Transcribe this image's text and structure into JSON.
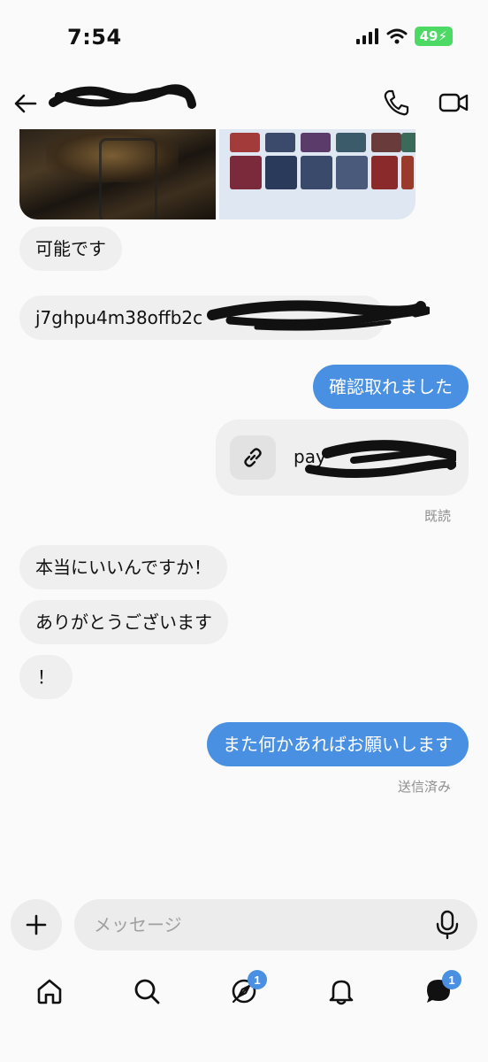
{
  "status_bar": {
    "time": "7:54",
    "battery": "49"
  },
  "header": {
    "contact_name": ""
  },
  "messages": {
    "m1": "可能です",
    "m2": "j7ghpu4m38offb2c",
    "m3": "確認取れました",
    "m4_link": "pay",
    "m4_read": "既読",
    "m5": "本当にいいんですか！",
    "m6": "ありがとうございます",
    "m7": "！",
    "m8": "また何かあればお願いします",
    "m8_status": "送信済み"
  },
  "composer": {
    "placeholder": "メッセージ"
  },
  "nav": {
    "discover_badge": "1",
    "messages_badge": "1"
  },
  "colors": {
    "outgoing": "#4a90e2",
    "incoming": "#efefef",
    "badge": "#4a90e2"
  },
  "icons": [
    "back-arrow-icon",
    "phone-icon",
    "video-camera-icon",
    "link-icon",
    "plus-icon",
    "microphone-icon",
    "home-icon",
    "search-icon",
    "compass-icon",
    "bell-icon",
    "chat-bubble-icon"
  ]
}
